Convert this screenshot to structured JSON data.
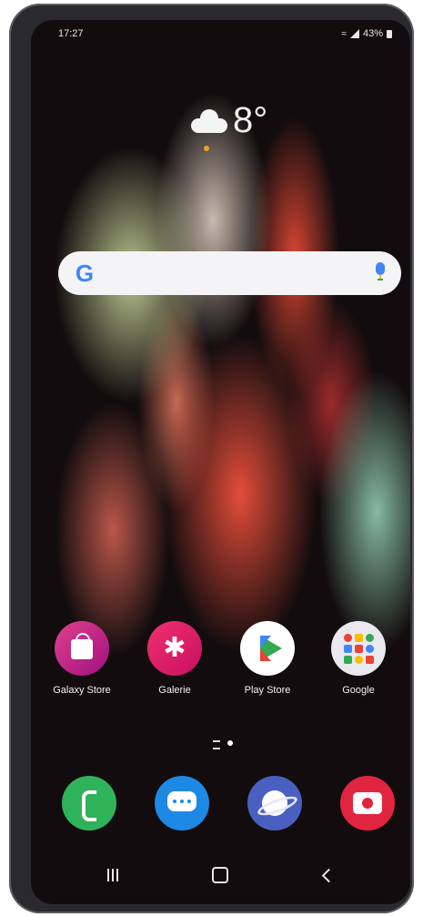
{
  "status_bar": {
    "time": "17:27",
    "battery": "43%"
  },
  "weather": {
    "temperature": "8°",
    "icon": "cloud-icon"
  },
  "search_bar": {
    "logo": "G",
    "icon": "mic-icon"
  },
  "apps": [
    {
      "label": "Galaxy Store",
      "icon": "shopping-bag-icon",
      "color": "#d0206a"
    },
    {
      "label": "Galerie",
      "icon": "flower-icon",
      "color": "#e01e6a"
    },
    {
      "label": "Play Store",
      "icon": "play-triangle-icon",
      "color": "#ffffff"
    },
    {
      "label": "Google",
      "icon": "google-folder-icon",
      "color": "#e8e8ee"
    }
  ],
  "dock": [
    {
      "icon": "phone-icon",
      "color": "#2fb35a"
    },
    {
      "icon": "messages-icon",
      "color": "#1e88e5"
    },
    {
      "icon": "internet-icon",
      "color": "#4a60c0"
    },
    {
      "icon": "camera-icon",
      "color": "#e2253e"
    }
  ],
  "nav": {
    "recents_icon": "recents-icon",
    "home_icon": "home-icon",
    "back_icon": "back-icon"
  }
}
